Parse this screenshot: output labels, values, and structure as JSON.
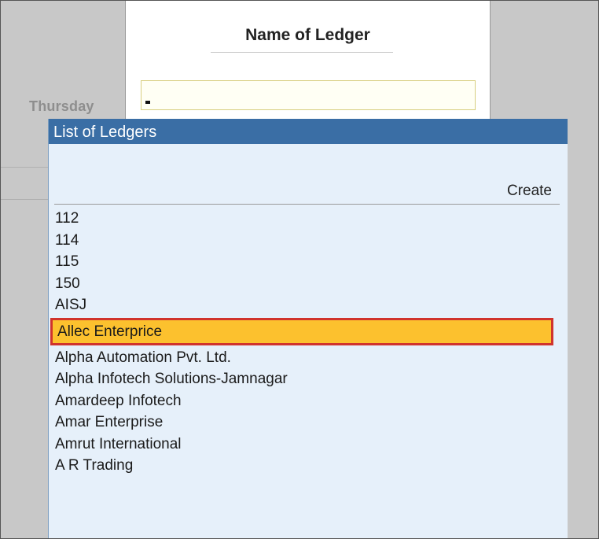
{
  "header": {
    "date_label": "Thursday",
    "title": "Name of Ledger",
    "input_value": "-"
  },
  "list": {
    "title": "List of Ledgers",
    "create_label": "Create",
    "selected_index": 5,
    "items": [
      "112",
      "114",
      "115",
      "150",
      "AISJ",
      "Allec Enterprice",
      "Alpha Automation Pvt. Ltd.",
      "Alpha Infotech Solutions-Jamnagar",
      "Amardeep Infotech",
      "Amar Enterprise",
      "Amrut International",
      "A R Trading"
    ]
  },
  "colors": {
    "header_bg": "#3a6ea5",
    "list_bg": "#e6f0fa",
    "selected_bg": "#fcc12e",
    "selected_border": "#d0332c"
  }
}
